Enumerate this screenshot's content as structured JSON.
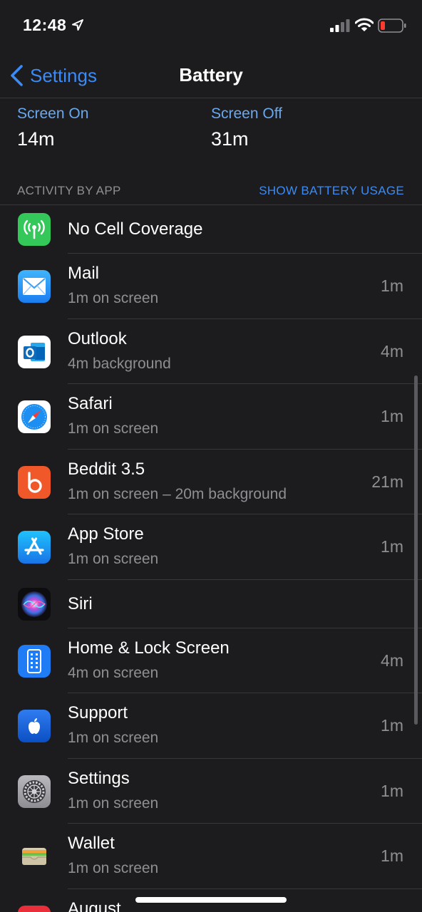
{
  "status_bar": {
    "time": "12:48",
    "icons": [
      "location-arrow-icon",
      "cellular-signal-icon",
      "wifi-icon",
      "battery-low-icon"
    ]
  },
  "nav": {
    "back_label": "Settings",
    "title": "Battery"
  },
  "screen_stats": {
    "on_label": "Screen On",
    "on_value": "14m",
    "off_label": "Screen Off",
    "off_value": "31m"
  },
  "section": {
    "title": "ACTIVITY BY APP",
    "action": "SHOW BATTERY USAGE"
  },
  "apps": [
    {
      "name": "No Cell Coverage",
      "detail": "",
      "time": "",
      "icon": "antenna-icon"
    },
    {
      "name": "Mail",
      "detail": "1m on screen",
      "time": "1m",
      "icon": "mail-icon"
    },
    {
      "name": "Outlook",
      "detail": "4m background",
      "time": "4m",
      "icon": "outlook-icon"
    },
    {
      "name": "Safari",
      "detail": "1m on screen",
      "time": "1m",
      "icon": "safari-icon"
    },
    {
      "name": "Beddit 3.5",
      "detail": "1m on screen – 20m background",
      "time": "21m",
      "icon": "beddit-icon"
    },
    {
      "name": "App Store",
      "detail": "1m on screen",
      "time": "1m",
      "icon": "app-store-icon"
    },
    {
      "name": "Siri",
      "detail": "",
      "time": "",
      "icon": "siri-icon"
    },
    {
      "name": "Home & Lock Screen",
      "detail": "4m on screen",
      "time": "4m",
      "icon": "home-lock-screen-icon"
    },
    {
      "name": "Support",
      "detail": "1m on screen",
      "time": "1m",
      "icon": "apple-support-icon"
    },
    {
      "name": "Settings",
      "detail": "1m on screen",
      "time": "1m",
      "icon": "settings-gear-icon"
    },
    {
      "name": "Wallet",
      "detail": "1m on screen",
      "time": "1m",
      "icon": "wallet-icon"
    },
    {
      "name": "August",
      "detail": "",
      "time": "",
      "icon": "august-icon"
    }
  ],
  "colors": {
    "background": "#1c1c1e",
    "accent": "#3a8bf5",
    "secondary_text": "#8e8e93",
    "battery_low": "#ff3b30"
  }
}
